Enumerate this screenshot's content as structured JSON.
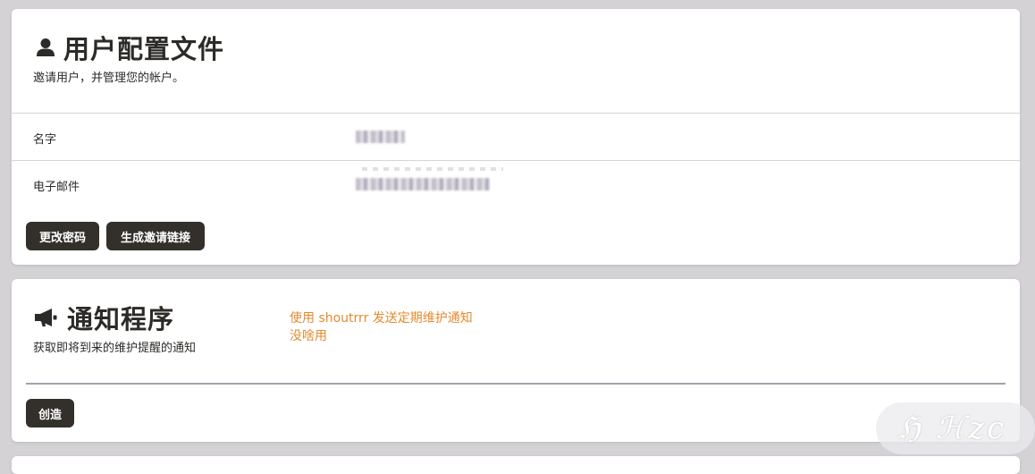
{
  "profile": {
    "title": "用户配置文件",
    "subtitle": "邀请用户，并管理您的帐户。",
    "fields": [
      {
        "label": "名字"
      },
      {
        "label": "电子邮件"
      }
    ],
    "buttons": {
      "change_password": "更改密码",
      "generate_invite": "生成邀请链接"
    },
    "icon": "user-icon"
  },
  "notifier": {
    "title": "通知程序",
    "subtitle": "获取即将到来的维护提醒的通知",
    "note_line1": "使用 shoutrrr 发送定期维护通知",
    "note_line2": "没啥用",
    "create_label": "创造",
    "icon": "megaphone-icon"
  },
  "watermark": "Hzc",
  "colors": {
    "background": "#d4d2d5",
    "card": "#ffffff",
    "button": "#33302b",
    "note": "#e38b2f"
  }
}
